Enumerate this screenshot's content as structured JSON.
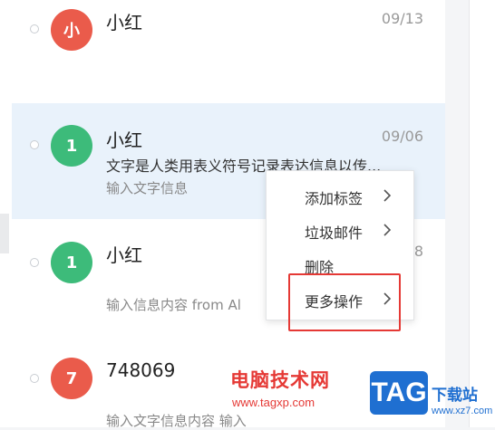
{
  "colors": {
    "avatar_red": "#ea5b4b",
    "avatar_green": "#3dbb7a",
    "selected_bg": "#e9f2fb",
    "highlight": "#e53935",
    "watermark_blue": "#1f6fd1"
  },
  "mails": [
    {
      "avatar": "小",
      "sender": "小红",
      "date": "09/13",
      "subject": "",
      "preview": ""
    },
    {
      "avatar": "1",
      "sender": "小红",
      "date": "09/06",
      "subject": "文字是人类用表义符号记录表达信息以传...",
      "preview": "输入文字信息"
    },
    {
      "avatar": "1",
      "sender": "小红",
      "date": "8",
      "subject": "",
      "preview": "输入信息内容 from Al"
    },
    {
      "avatar": "7",
      "sender": "748069",
      "date": "",
      "subject": "",
      "preview": "输入文字信息内容 输入"
    }
  ],
  "context_menu": {
    "items": [
      {
        "label": "添加标签",
        "icon": "chevron-right-icon"
      },
      {
        "label": "垃圾邮件",
        "icon": "chevron-right-icon"
      },
      {
        "label": "删除",
        "icon": ""
      },
      {
        "label": "更多操作",
        "icon": "chevron-right-icon"
      }
    ]
  },
  "watermark": {
    "text": "电脑技术网",
    "url": "www.tagxp.com",
    "logo": "TAG",
    "site": "下载站",
    "site_url": "www.xz7.com"
  }
}
